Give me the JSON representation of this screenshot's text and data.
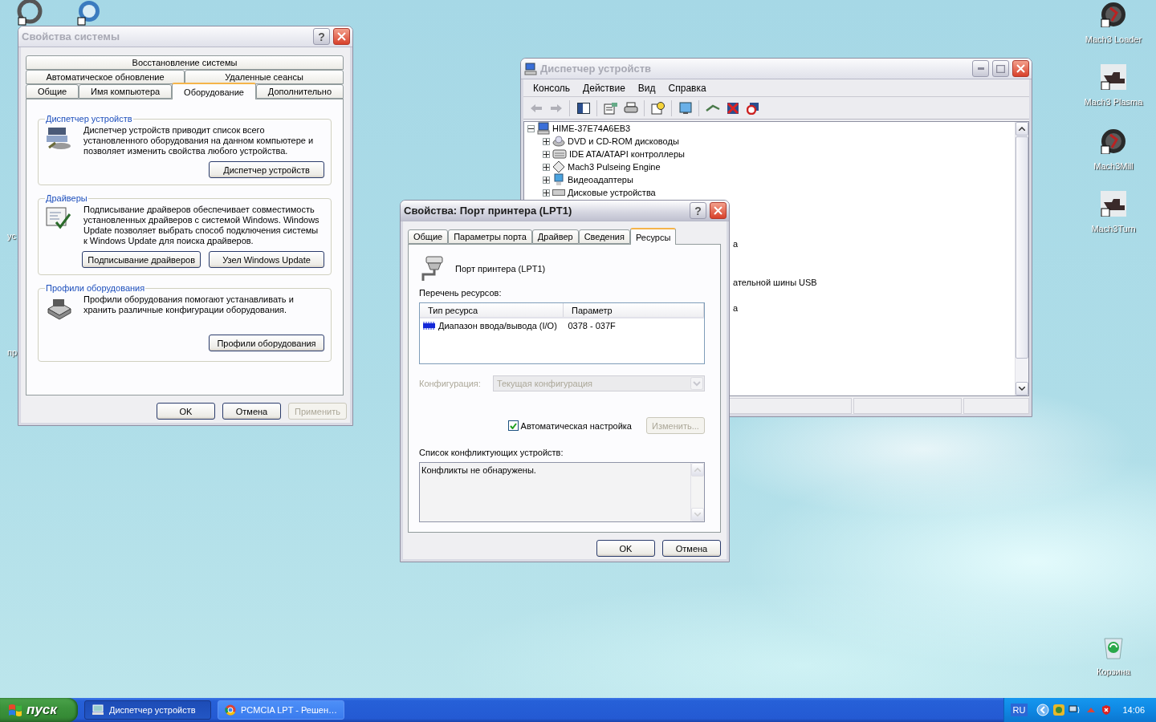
{
  "desktop": {
    "cut_labels": [
      {
        "text": "ус"
      },
      {
        "text": "пр"
      }
    ],
    "icons": [
      {
        "label": "Mach3 Loader",
        "kind": "logo"
      },
      {
        "label": "Mach3 Plasma",
        "kind": "machine"
      },
      {
        "label": "Mach3Mill",
        "kind": "logo"
      },
      {
        "label": "Mach3Turn",
        "kind": "machine"
      },
      {
        "label": "Корзина",
        "kind": "recycle"
      }
    ]
  },
  "system_properties": {
    "title": "Свойства системы",
    "active": false,
    "help": "?",
    "tab_rows": [
      [
        {
          "label": "Восстановление системы",
          "selected": false
        }
      ],
      [
        {
          "label": "Автоматическое обновление",
          "selected": false
        },
        {
          "label": "Удаленные сеансы",
          "selected": false
        }
      ],
      [
        {
          "label": "Общие",
          "selected": false
        },
        {
          "label": "Имя компьютера",
          "selected": false
        },
        {
          "label": "Оборудование",
          "selected": true
        },
        {
          "label": "Дополнительно",
          "selected": false
        }
      ]
    ],
    "groups": [
      {
        "title": "Диспетчер устройств",
        "text": "Диспетчер устройств приводит список всего установленного оборудования на данном компьютере и позволяет изменить свойства любого устройства.",
        "buttons": [
          "Диспетчер устройств"
        ]
      },
      {
        "title": "Драйверы",
        "text": "Подписывание драйверов обеспечивает совместимость установленных драйверов с системой Windows.  Windows Update позволяет выбрать способ подключения системы к Windows Update для поиска драйверов.",
        "buttons": [
          "Подписывание драйверов",
          "Узел Windows Update"
        ]
      },
      {
        "title": "Профили оборудования",
        "text": "Профили оборудования помогают устанавливать и хранить различные конфигурации оборудования.",
        "buttons": [
          "Профили оборудования"
        ]
      }
    ],
    "buttons": [
      {
        "label": "OK",
        "disabled": false
      },
      {
        "label": "Отмена",
        "disabled": false
      },
      {
        "label": "Применить",
        "disabled": true
      }
    ]
  },
  "device_manager": {
    "title": "Диспетчер устройств",
    "active": false,
    "menu": [
      "Консоль",
      "Действие",
      "Вид",
      "Справка"
    ],
    "tree": {
      "label": "HIME-37E74A6EB3",
      "expanded": true,
      "children": [
        {
          "label": "DVD и CD-ROM дисководы",
          "expanded": false
        },
        {
          "label": "IDE ATA/ATAPI контроллеры",
          "expanded": false
        },
        {
          "label": "Mach3 Pulseing Engine",
          "expanded": false
        },
        {
          "label": "Видеоадаптеры",
          "expanded": false
        },
        {
          "label": "Дисковые устройства",
          "expanded": false
        }
      ]
    },
    "clipped_rows": [
      {
        "text": "а"
      },
      {
        "text": "ательной шины USB"
      },
      {
        "text": "а"
      }
    ]
  },
  "dialog": {
    "title": "Свойства: Порт принтера (LPT1)",
    "active": true,
    "help": "?",
    "tabs": [
      {
        "label": "Общие",
        "selected": false
      },
      {
        "label": "Параметры порта",
        "selected": false
      },
      {
        "label": "Драйвер",
        "selected": false
      },
      {
        "label": "Сведения",
        "selected": false
      },
      {
        "label": "Ресурсы",
        "selected": true
      }
    ],
    "device": "Порт принтера (LPT1)",
    "resources_label": "Перечень ресурсов:",
    "columns": [
      "Тип ресурса",
      "Параметр"
    ],
    "rows": [
      [
        "Диапазон ввода/вывода (I/O)",
        "0378 - 037F"
      ]
    ],
    "config": {
      "label": "Конфигурация:",
      "value": "Текущая конфигурация",
      "disabled": true
    },
    "auto": {
      "label": "Автоматическая настройка",
      "checked": true
    },
    "change": {
      "label": "Изменить...",
      "disabled": true
    },
    "conflicts_label": "Список конфликтующих устройств:",
    "conflicts_text": "Конфликты не обнаружены.",
    "buttons": [
      {
        "label": "OK",
        "disabled": false
      },
      {
        "label": "Отмена",
        "disabled": false
      }
    ]
  },
  "taskbar": {
    "start": "пуск",
    "tasks": [
      {
        "label": "Диспетчер устройств",
        "selected": true
      },
      {
        "label": "PCMCIA LPT - Решен…",
        "selected": false
      }
    ],
    "language": "RU",
    "clock": "14:06"
  }
}
